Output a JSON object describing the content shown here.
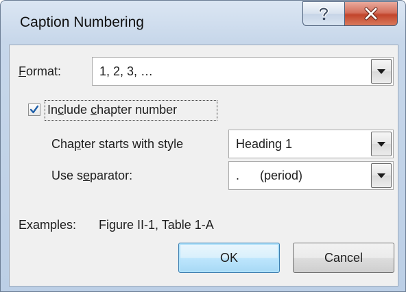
{
  "dialog": {
    "title": "Caption Numbering"
  },
  "format": {
    "label": "Format:",
    "label_hotkey": "F",
    "label_rest": "ormat:",
    "value": "1, 2, 3, …"
  },
  "include_chapter": {
    "checked": true,
    "label_pre": "In",
    "label_hotkey1": "c",
    "label_mid": "lude ",
    "label_hotkey2": "c",
    "label_post": "hapter number"
  },
  "chapter_style": {
    "label_pre": "Cha",
    "label_hotkey": "p",
    "label_post": "ter starts with style",
    "value": "Heading 1"
  },
  "separator": {
    "label_pre": "Use s",
    "label_hotkey": "e",
    "label_post": "parator:",
    "value": ".      (period)"
  },
  "examples": {
    "label": "Examples:",
    "value": "Figure II-1, Table 1-A"
  },
  "buttons": {
    "ok": "OK",
    "cancel": "Cancel"
  },
  "colors": {
    "close_button": "#c2452c",
    "default_button_border": "#3c7fb1",
    "checkmark": "#1f5fa8"
  }
}
